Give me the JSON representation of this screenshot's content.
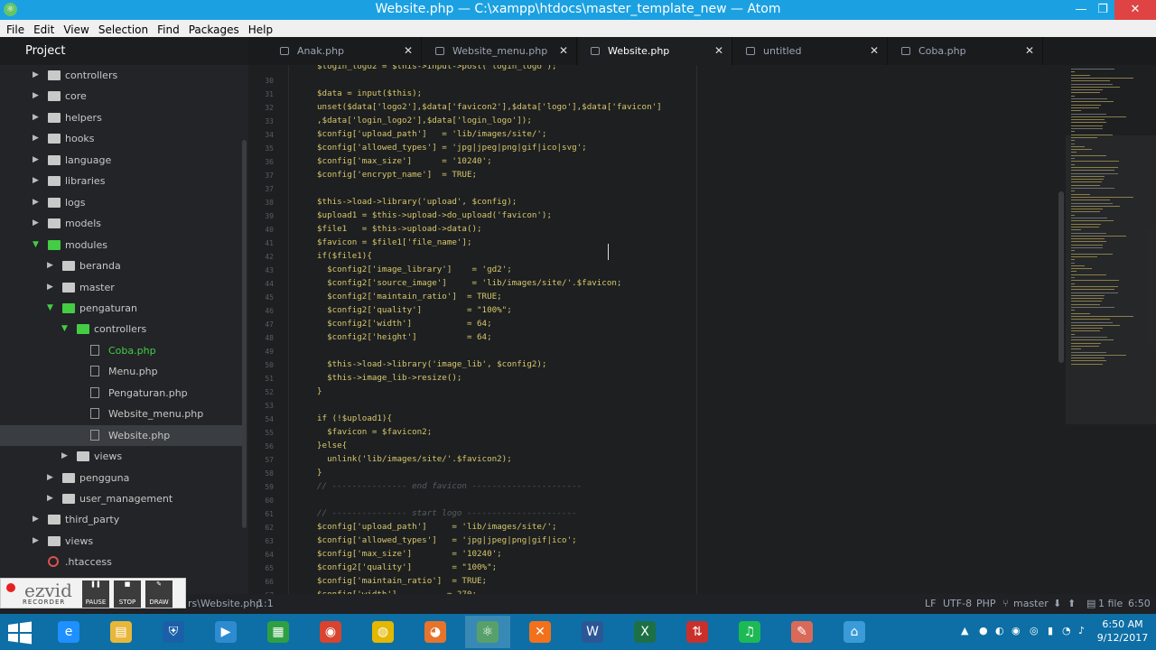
{
  "window": {
    "title": "Website.php — C:\\xampp\\htdocs\\master_template_new — Atom"
  },
  "menu": [
    "File",
    "Edit",
    "View",
    "Selection",
    "Find",
    "Packages",
    "Help"
  ],
  "sidebar": {
    "title": "Project",
    "items": [
      {
        "label": "controllers",
        "depth": 1,
        "type": "folder",
        "open": false
      },
      {
        "label": "core",
        "depth": 1,
        "type": "folder",
        "open": false
      },
      {
        "label": "helpers",
        "depth": 1,
        "type": "folder",
        "open": false
      },
      {
        "label": "hooks",
        "depth": 1,
        "type": "folder",
        "open": false
      },
      {
        "label": "language",
        "depth": 1,
        "type": "folder",
        "open": false
      },
      {
        "label": "libraries",
        "depth": 1,
        "type": "folder",
        "open": false
      },
      {
        "label": "logs",
        "depth": 1,
        "type": "folder",
        "open": false
      },
      {
        "label": "models",
        "depth": 1,
        "type": "folder",
        "open": false
      },
      {
        "label": "modules",
        "depth": 1,
        "type": "folder",
        "open": true
      },
      {
        "label": "beranda",
        "depth": 2,
        "type": "folder",
        "open": false
      },
      {
        "label": "master",
        "depth": 2,
        "type": "folder",
        "open": false
      },
      {
        "label": "pengaturan",
        "depth": 2,
        "type": "folder",
        "open": true
      },
      {
        "label": "controllers",
        "depth": 3,
        "type": "folder",
        "open": true
      },
      {
        "label": "Coba.php",
        "depth": 4,
        "type": "file",
        "green": true
      },
      {
        "label": "Menu.php",
        "depth": 4,
        "type": "file"
      },
      {
        "label": "Pengaturan.php",
        "depth": 4,
        "type": "file"
      },
      {
        "label": "Website_menu.php",
        "depth": 4,
        "type": "file"
      },
      {
        "label": "Website.php",
        "depth": 4,
        "type": "file",
        "selected": true
      },
      {
        "label": "views",
        "depth": 3,
        "type": "folder",
        "open": false
      },
      {
        "label": "pengguna",
        "depth": 2,
        "type": "folder",
        "open": false
      },
      {
        "label": "user_management",
        "depth": 2,
        "type": "folder",
        "open": false
      },
      {
        "label": "third_party",
        "depth": 1,
        "type": "folder",
        "open": false
      },
      {
        "label": "views",
        "depth": 1,
        "type": "folder",
        "open": false
      },
      {
        "label": ".htaccess",
        "depth": 1,
        "type": "config"
      }
    ]
  },
  "tabs": [
    {
      "label": "Anak.php",
      "active": false
    },
    {
      "label": "Website_menu.php",
      "active": false
    },
    {
      "label": "Website.php",
      "active": true
    },
    {
      "label": "untitled",
      "active": false
    },
    {
      "label": "Coba.php",
      "active": false
    }
  ],
  "editor": {
    "lines": [
      {
        "n": "",
        "t": "$login_logo2 = $this->input->post('login_logo');"
      },
      {
        "n": "30",
        "t": ""
      },
      {
        "n": "31",
        "t": "$data = input($this);"
      },
      {
        "n": "32",
        "t": "unset($data['logo2'],$data['favicon2'],$data['logo'],$data['favicon']"
      },
      {
        "n": "33",
        "t": ",$data['login_logo2'],$data['login_logo']);"
      },
      {
        "n": "34",
        "t": "$config['upload_path']   = 'lib/images/site/';"
      },
      {
        "n": "35",
        "t": "$config['allowed_types'] = 'jpg|jpeg|png|gif|ico|svg';"
      },
      {
        "n": "36",
        "t": "$config['max_size']      = '10240';"
      },
      {
        "n": "37",
        "t": "$config['encrypt_name']  = TRUE;"
      },
      {
        "n": "37",
        "t": ""
      },
      {
        "n": "38",
        "t": "$this->load->library('upload', $config);"
      },
      {
        "n": "39",
        "t": "$upload1 = $this->upload->do_upload('favicon');"
      },
      {
        "n": "40",
        "t": "$file1   = $this->upload->data();"
      },
      {
        "n": "41",
        "t": "$favicon = $file1['file_name'];"
      },
      {
        "n": "42",
        "t": "if($file1){"
      },
      {
        "n": "43",
        "t": "  $config2['image_library']    = 'gd2';"
      },
      {
        "n": "44",
        "t": "  $config2['source_image']     = 'lib/images/site/'.$favicon;"
      },
      {
        "n": "45",
        "t": "  $config2['maintain_ratio']  = TRUE;"
      },
      {
        "n": "46",
        "t": "  $config2['quality']         = \"100%\";"
      },
      {
        "n": "47",
        "t": "  $config2['width']           = 64;"
      },
      {
        "n": "48",
        "t": "  $config2['height']          = 64;"
      },
      {
        "n": "49",
        "t": ""
      },
      {
        "n": "50",
        "t": "  $this->load->library('image_lib', $config2);"
      },
      {
        "n": "51",
        "t": "  $this->image_lib->resize();"
      },
      {
        "n": "52",
        "t": "}"
      },
      {
        "n": "53",
        "t": ""
      },
      {
        "n": "54",
        "t": "if (!$upload1){"
      },
      {
        "n": "55",
        "t": "  $favicon = $favicon2;"
      },
      {
        "n": "56",
        "t": "}else{"
      },
      {
        "n": "57",
        "t": "  unlink('lib/images/site/'.$favicon2);"
      },
      {
        "n": "58",
        "t": "}"
      },
      {
        "n": "59",
        "t": "// --------------- end favicon ----------------------",
        "comment": true
      },
      {
        "n": "60",
        "t": ""
      },
      {
        "n": "61",
        "t": "// --------------- start logo ----------------------",
        "comment": true
      },
      {
        "n": "62",
        "t": "$config['upload_path']     = 'lib/images/site/';"
      },
      {
        "n": "63",
        "t": "$config['allowed_types']   = 'jpg|jpeg|png|gif|ico';"
      },
      {
        "n": "64",
        "t": "$config['max_size']        = '10240';"
      },
      {
        "n": "65",
        "t": "$config2['quality']        = \"100%\";"
      },
      {
        "n": "66",
        "t": "$config['maintain_ratio']  = TRUE;"
      },
      {
        "n": "67",
        "t": "$config['width']          = 270;"
      }
    ]
  },
  "status": {
    "path": "rs\\Website.php",
    "cursor": "1:1",
    "line_ending": "LF",
    "encoding": "UTF-8",
    "grammar": "PHP",
    "branch": "master",
    "files": "1 file",
    "time_spent": "6:50"
  },
  "ezvid": {
    "logo": "ezvid",
    "sub": "RECORDER",
    "buttons": [
      "PAUSE",
      "STOP",
      "DRAW"
    ]
  },
  "taskbar": {
    "apps": [
      "internet-explorer",
      "file-explorer",
      "security",
      "media-player",
      "store",
      "video-app",
      "chrome",
      "firefox",
      "atom",
      "xampp",
      "word",
      "excel",
      "filezilla",
      "spotify",
      "paint",
      "network"
    ],
    "active_app": "atom",
    "time": "6:50 AM",
    "date": "9/12/2017"
  }
}
